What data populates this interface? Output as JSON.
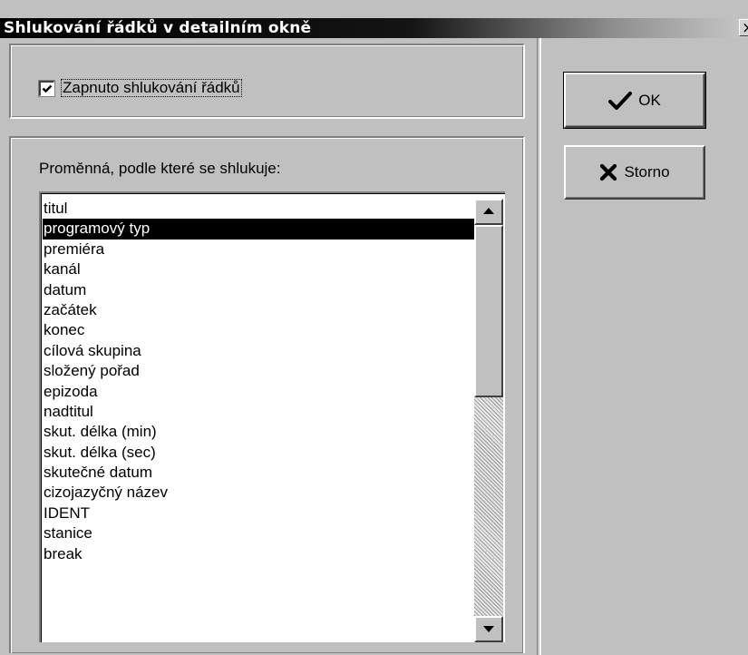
{
  "window": {
    "title": "Shlukování řádků v detailním okně",
    "close_glyph": "×"
  },
  "grouping": {
    "enabled_label": "Zapnuto shlukování řádků",
    "enabled": true
  },
  "variable": {
    "label": "Proměnná, podle které se shlukuje:",
    "selected_index": 1,
    "items": [
      "titul",
      "programový typ",
      "premiéra",
      "kanál",
      "datum",
      "začátek",
      "konec",
      "cílová skupina",
      "složený pořad",
      "epizoda",
      "nadtitul",
      "skut. délka (min)",
      "skut. délka (sec)",
      "skutečné datum",
      "cizojazyčný název",
      "IDENT",
      "stanice",
      "break"
    ]
  },
  "buttons": {
    "ok_label": "OK",
    "ok_icon": "checkmark-icon",
    "cancel_label": "Storno",
    "cancel_icon": "x-icon"
  }
}
